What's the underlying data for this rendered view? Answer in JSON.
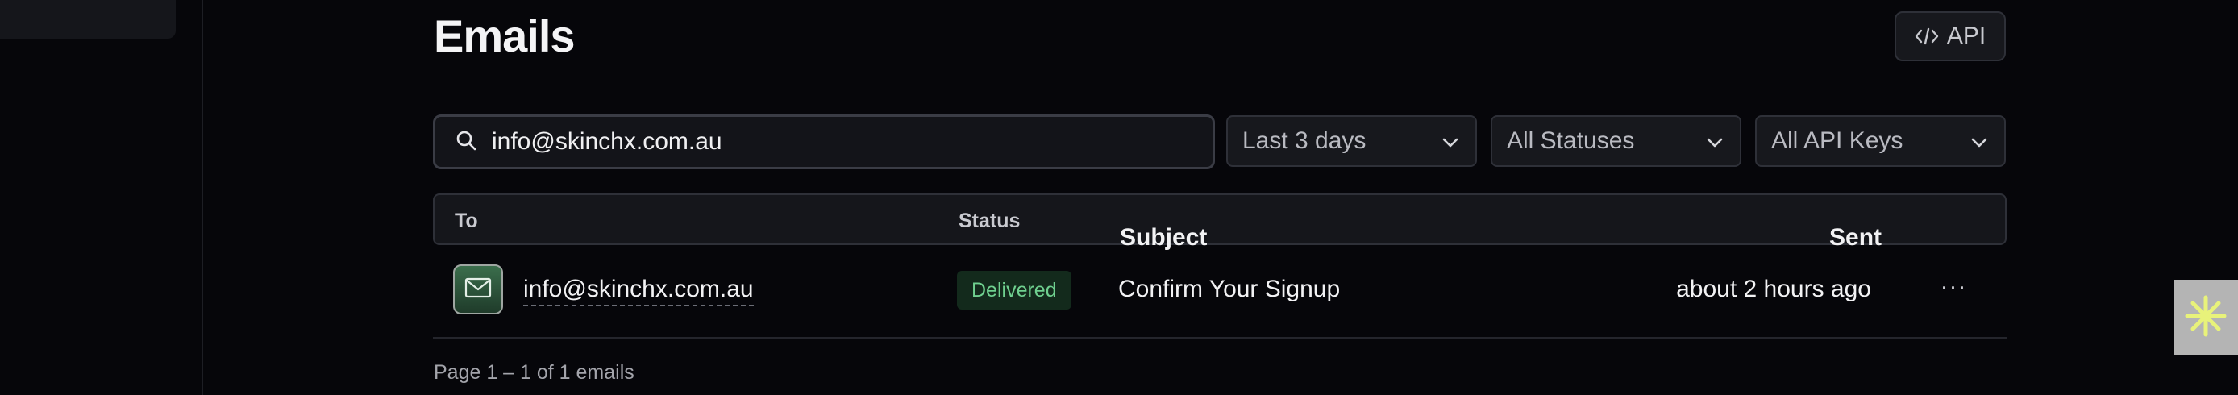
{
  "page": {
    "title": "Emails",
    "api_button": {
      "label": "API",
      "icon": "code-icon"
    }
  },
  "filters": {
    "search": {
      "value": "info@skinchx.com.au",
      "icon": "search-icon"
    },
    "date_range": {
      "selected": "Last 3 days"
    },
    "status": {
      "selected": "All Statuses"
    },
    "api_keys": {
      "selected": "All API Keys"
    }
  },
  "table": {
    "columns": [
      "To",
      "Status",
      "Subject",
      "Sent"
    ],
    "rows": [
      {
        "to": "info@skinchx.com.au",
        "status": "Delivered",
        "subject": "Confirm Your Signup",
        "sent": "about 2 hours ago",
        "actions_label": "···"
      }
    ]
  },
  "pagination": {
    "text": "Page 1 – 1 of 1 emails"
  },
  "colors": {
    "background": "#06060a",
    "status_delivered_bg": "#132a1c",
    "status_delivered_text": "#6fd08f",
    "widget_accent": "#e8f27a"
  }
}
